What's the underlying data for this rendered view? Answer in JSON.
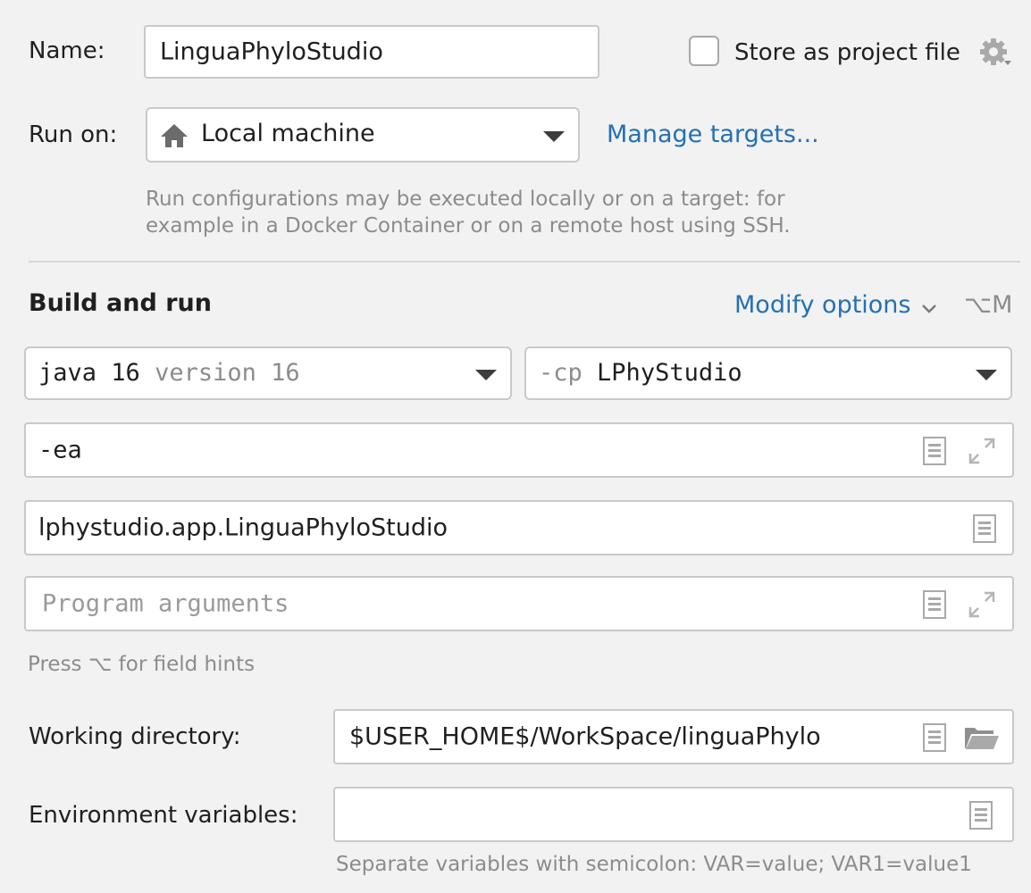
{
  "name": {
    "label": "Name:",
    "value": "LinguaPhyloStudio"
  },
  "store_project_file": {
    "label": "Store as project file",
    "checked": false
  },
  "run_on": {
    "label": "Run on:",
    "value": "Local machine",
    "manage_link": "Manage targets..."
  },
  "run_on_hint": [
    "Run configurations may be executed locally or on a target: for",
    "example in a Docker Container or on a remote host using SSH."
  ],
  "build": {
    "heading": "Build and run",
    "modify_options": "Modify options",
    "shortcut": "⌥M",
    "jdk": {
      "name": "java 16",
      "version": "version 16"
    },
    "classpath": {
      "flag": "-cp",
      "module": "LPhyStudio"
    },
    "vm_options": "-ea",
    "main_class": "lphystudio.app.LinguaPhyloStudio",
    "program_args_placeholder": "Program arguments",
    "field_hints": "Press ⌥ for field hints"
  },
  "working_dir": {
    "label": "Working directory:",
    "value": "$USER_HOME$/WorkSpace/linguaPhylo"
  },
  "env_vars": {
    "label": "Environment variables:",
    "value": "",
    "hint": "Separate variables with semicolon: VAR=value; VAR1=value1"
  },
  "colors": {
    "link": "#2470b3",
    "hint": "#8c8c8c",
    "background": "#f2f2f2"
  }
}
